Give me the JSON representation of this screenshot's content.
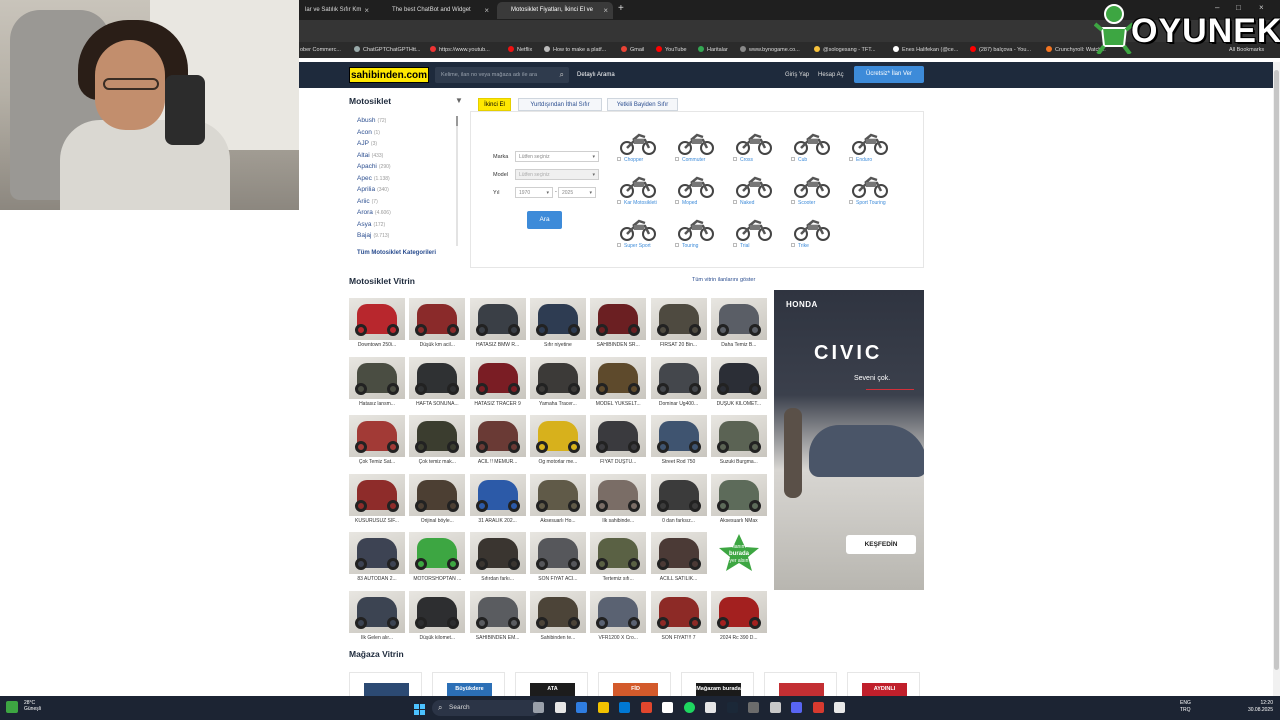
{
  "browser": {
    "tabs": [
      {
        "title": "lar ve Satılık Sıfır Km",
        "active": false
      },
      {
        "title": "The best ChatBot and Widget",
        "active": false
      },
      {
        "title": "Motosiklet Fiyatları, İkinci El ve",
        "active": true
      }
    ],
    "new_tab": "+",
    "bookmarks": [
      "ober Commerc...",
      "ChatGPTChatGPTHtt...",
      "https://www.youtub...",
      "Netflix",
      "How to make a platf...",
      "Gmail",
      "YouTube",
      "Haritalar",
      "www.bynogame.co...",
      "@sologesang - TFT...",
      "Enes Halifekan (@ce...",
      "(287) balçova - You...",
      "Crunchyroll: Watch...",
      "All Bookmarks"
    ],
    "close_glyph": "×"
  },
  "overlay": {
    "brand": "OYUNEKS"
  },
  "header": {
    "logo": "sahibinden.com",
    "search_placeholder": "Kelime, ilan no veya mağaza adı ile ara",
    "advanced_search": "Detaylı Arama",
    "login": "Giriş Yap",
    "register": "Hesap Aç",
    "post_ad": "Ücretsiz* İlan Ver"
  },
  "sidebar": {
    "title": "Motosiklet",
    "categories": [
      {
        "name": "Abush",
        "count": "(72)"
      },
      {
        "name": "Acon",
        "count": "(1)"
      },
      {
        "name": "AJP",
        "count": "(3)"
      },
      {
        "name": "Altai",
        "count": "(433)"
      },
      {
        "name": "Apachi",
        "count": "(290)"
      },
      {
        "name": "Apec",
        "count": "(1.138)"
      },
      {
        "name": "Aprilia",
        "count": "(340)"
      },
      {
        "name": "Ariic",
        "count": "(7)"
      },
      {
        "name": "Arora",
        "count": "(4.606)"
      },
      {
        "name": "Asya",
        "count": "(172)"
      },
      {
        "name": "Bajaj",
        "count": "(9.713)"
      }
    ],
    "all_categories": "Tüm Motosiklet Kategorileri"
  },
  "search_tabs": [
    "İkinci El",
    "Yurtdışından İthal Sıfır",
    "Yetkili Bayiden Sıfır"
  ],
  "filters": {
    "brand_label": "Marka",
    "brand_value": "Lütfen seçiniz",
    "model_label": "Model",
    "model_value": "Lütfen seçiniz",
    "year_label": "Yıl",
    "year_from": "1970",
    "year_sep": "-",
    "year_to": "2025",
    "search_button": "Ara"
  },
  "moto_types": [
    "Chopper",
    "Commuter",
    "Cross",
    "Cub",
    "Enduro",
    "Kar Motosikleti",
    "Moped",
    "Naked",
    "Scooter",
    "Sport Touring",
    "Super Sport",
    "Touring",
    "Trial",
    "Trike"
  ],
  "vitrin": {
    "title": "Motosiklet Vitrin",
    "all_link": "Tüm vitrin ilanlarını göster",
    "items": [
      {
        "caption": "Downtown 250i...",
        "color": "#b8272d"
      },
      {
        "caption": "Düşük km acil...",
        "color": "#8a2a2a"
      },
      {
        "caption": "HATASIZ BMW R...",
        "color": "#3a3f46"
      },
      {
        "caption": "Sıfır niyetine",
        "color": "#2e3c52"
      },
      {
        "caption": "SAHİBİNDEN SR...",
        "color": "#6b1f22"
      },
      {
        "caption": "FIRSAT 20 Bin...",
        "color": "#4e4a40"
      },
      {
        "caption": "Daha Temiz B...",
        "color": "#5a5e66"
      },
      {
        "caption": "Hatasız lansm...",
        "color": "#4a4d42"
      },
      {
        "caption": "HAFTA SONUNA...",
        "color": "#2f3133"
      },
      {
        "caption": "HATASIZ TRACER 9",
        "color": "#7a1d24"
      },
      {
        "caption": "Yamaha Tracer...",
        "color": "#3c3a38"
      },
      {
        "caption": "MODEL YÜKSELT...",
        "color": "#5e4a2c"
      },
      {
        "caption": "Dominar Ug400...",
        "color": "#44474c"
      },
      {
        "caption": "DÜŞÜK KİLOMET...",
        "color": "#2b2e36"
      },
      {
        "caption": "Çok Temiz Sat...",
        "color": "#a23a36"
      },
      {
        "caption": "Çok temiz mak...",
        "color": "#3b3d2f"
      },
      {
        "caption": "ACİL !! MEMUR...",
        "color": "#6a3a35"
      },
      {
        "caption": "Ög motorlar me...",
        "color": "#d7b11c"
      },
      {
        "caption": "FİYAT DÜŞTÜ...",
        "color": "#3a3a3e"
      },
      {
        "caption": "Street Rod 750",
        "color": "#3f5470"
      },
      {
        "caption": "Suzuki Burgma...",
        "color": "#5b6354"
      },
      {
        "caption": "KUSURUSUZ SIF...",
        "color": "#8e2c2a"
      },
      {
        "caption": "Orijinal böyle...",
        "color": "#4c3f33"
      },
      {
        "caption": "31 ARALIK 202...",
        "color": "#2c5aa8"
      },
      {
        "caption": "Aksesuarlı Ho...",
        "color": "#605a48"
      },
      {
        "caption": "İlk sahibinde...",
        "color": "#7a6d66"
      },
      {
        "caption": "0 dan farksız...",
        "color": "#3b3b3b"
      },
      {
        "caption": "Aksesuarlı NMax",
        "color": "#5d6b5a"
      },
      {
        "caption": "83 AUTODAN 2...",
        "color": "#3d4353"
      },
      {
        "caption": "MOTORSHOPTAN ...",
        "color": "#3da642"
      },
      {
        "caption": "Sıfırdan farkı...",
        "color": "#3a3530"
      },
      {
        "caption": "SON FİYAT ACİ...",
        "color": "#56575b"
      },
      {
        "caption": "Tertemiz sıfı...",
        "color": "#5a6144"
      },
      {
        "caption": "ACİLL SATILIK...",
        "color": "#4b3a36"
      },
      {
        "caption": "",
        "color": "#ffffff"
      },
      {
        "caption": "İlk Gelen alır...",
        "color": "#3c4452"
      },
      {
        "caption": "Düşük kilomet...",
        "color": "#2d2e30"
      },
      {
        "caption": "SAHİBİNDEN EM...",
        "color": "#5a5c60"
      },
      {
        "caption": "Sahibinden te...",
        "color": "#4c4438"
      },
      {
        "caption": "VFR1200 X Cro...",
        "color": "#5a6272"
      },
      {
        "caption": "SON FİYAT!!! 7",
        "color": "#8d2a26"
      },
      {
        "caption": "2024 Rc 390 D...",
        "color": "#a3201f"
      }
    ],
    "promo_text_1": "İlanım",
    "promo_text_2": "burada",
    "promo_text_3": "yer alsın"
  },
  "ad": {
    "brand": "HONDA",
    "model": "CIVIC",
    "tagline": "Seveni çok.",
    "cta": "KEŞFEDİN"
  },
  "magaza": {
    "title": "Mağaza Vitrin",
    "stores": [
      {
        "label": "",
        "color": "#2c4a73"
      },
      {
        "label": "Büyükdere",
        "color": "#2b6fb6"
      },
      {
        "label": "ATA",
        "color": "#1c1c1c"
      },
      {
        "label": "FİD",
        "color": "#d35a2b"
      },
      {
        "label": "Mağazam burada",
        "color": "#1a1a1a"
      },
      {
        "label": "",
        "color": "#c32f33"
      },
      {
        "label": "AYDINLI",
        "color": "#c01f2b"
      }
    ]
  },
  "taskbar": {
    "search": "Search",
    "weather_temp": "28°C",
    "weather_desc": "Güneşli",
    "lang_1": "ENG",
    "lang_2": "TRQ",
    "time": "12:20",
    "date": "30.08.2025"
  }
}
